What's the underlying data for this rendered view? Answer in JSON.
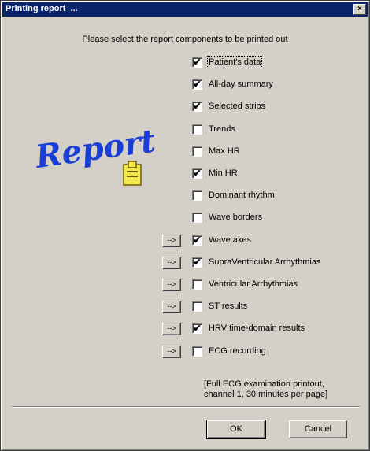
{
  "window": {
    "title": "Printing report  ...",
    "close_glyph": "×"
  },
  "instruction": "Please select the report components to be printed out",
  "logo": {
    "text": "Report",
    "color": "#1a3fd6"
  },
  "check_glyph": "✔",
  "items": [
    {
      "label": "Patient's data",
      "checked": true,
      "arrow": null
    },
    {
      "label": "All-day summary",
      "checked": true,
      "arrow": null
    },
    {
      "label": "Selected strips",
      "checked": true,
      "arrow": null
    },
    {
      "label": "Trends",
      "checked": false,
      "arrow": null
    },
    {
      "label": "Max HR",
      "checked": false,
      "arrow": null
    },
    {
      "label": "Min HR",
      "checked": true,
      "arrow": null
    },
    {
      "label": "Dominant rhythm",
      "checked": false,
      "arrow": null
    },
    {
      "label": "Wave borders",
      "checked": false,
      "arrow": null
    },
    {
      "label": "Wave axes",
      "checked": true,
      "arrow": "-->"
    },
    {
      "label": "SupraVentricular Arrhythmias",
      "checked": true,
      "arrow": "-->"
    },
    {
      "label": "Ventricular Arrhythmias",
      "checked": false,
      "arrow": "-->"
    },
    {
      "label": "ST results",
      "checked": false,
      "arrow": "-->"
    },
    {
      "label": "HRV time-domain results",
      "checked": true,
      "arrow": "-->"
    },
    {
      "label": "ECG recording",
      "checked": false,
      "arrow": "-->"
    }
  ],
  "note_line1": "[Full ECG examination printout,",
  "note_line2": "channel 1, 30 minutes per page]",
  "buttons": {
    "ok": "OK",
    "cancel": "Cancel"
  }
}
